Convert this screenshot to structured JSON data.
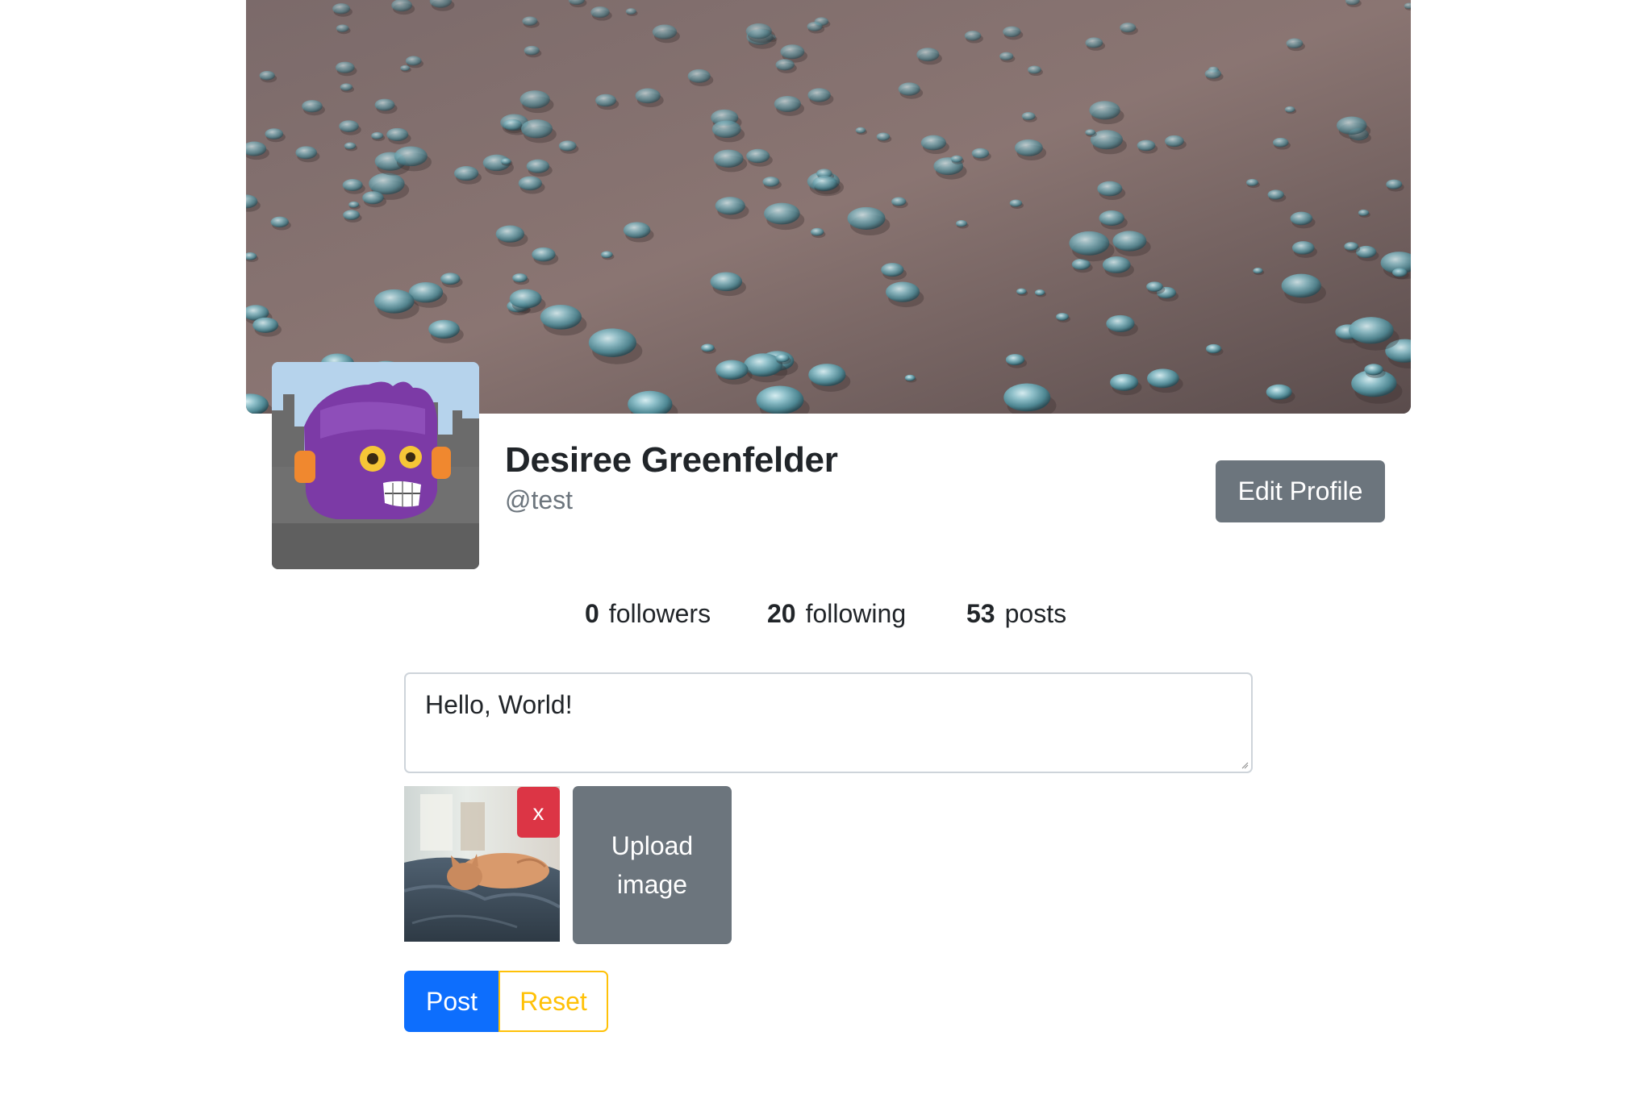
{
  "profile": {
    "name": "Desiree Greenfelder",
    "handle": "@test",
    "edit_label": "Edit Profile",
    "cover_alt": "cover photo",
    "avatar_alt": "avatar"
  },
  "stats": {
    "followers_count": "0",
    "followers_label": "followers",
    "following_count": "20",
    "following_label": "following",
    "posts_count": "53",
    "posts_label": "posts"
  },
  "composer": {
    "value": "Hello, World!"
  },
  "attachment": {
    "remove_label": "x",
    "upload_label": "Upload image"
  },
  "actions": {
    "post_label": "Post",
    "reset_label": "Reset"
  },
  "colors": {
    "primary": "#0d6efd",
    "secondary": "#6c757d",
    "danger": "#dc3545",
    "warning": "#ffc107"
  }
}
